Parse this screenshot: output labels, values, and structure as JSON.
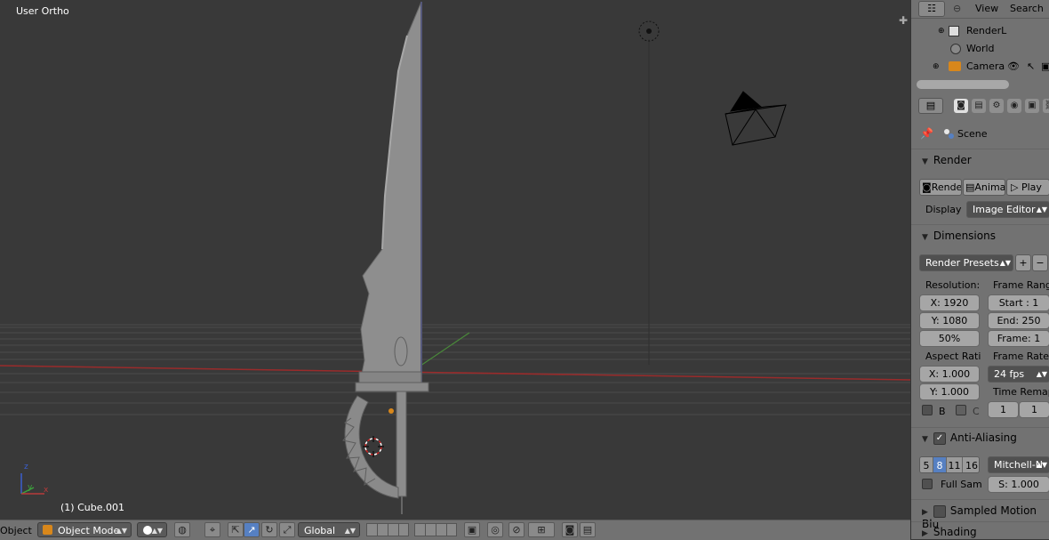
{
  "viewport": {
    "title": "User Ortho",
    "object_info": "(1) Cube.001",
    "axis_labels": {
      "z": "z",
      "y": "y",
      "x": "x"
    }
  },
  "bottombar": {
    "left_label": "Object",
    "mode": "Object Mode",
    "orientation": "Global"
  },
  "outliner": {
    "view_menu": "View",
    "search_menu": "Search",
    "items": [
      {
        "label": "RenderL",
        "icon": "render-layers-icon"
      },
      {
        "label": "World",
        "icon": "world-icon"
      },
      {
        "label": "Camera",
        "icon": "camera-icon"
      }
    ]
  },
  "properties": {
    "context": "Scene",
    "render": {
      "title": "Render",
      "render_btn": "Rende",
      "anim_btn": "Anima",
      "play_btn": "Play",
      "display_label": "Display",
      "display_value": "Image Editor"
    },
    "dimensions": {
      "title": "Dimensions",
      "presets": "Render Presets",
      "resolution_label": "Resolution:",
      "res_x": "X: 1920",
      "res_y": "Y: 1080",
      "res_pct": "50%",
      "frame_range_label": "Frame Rang",
      "start": "Start : 1",
      "end": "End: 250",
      "frame": "Frame: 1",
      "aspect_label": "Aspect Rati",
      "aspect_x": "X: 1.000",
      "aspect_y": "Y: 1.000",
      "frame_rate_label": "Frame Rate:",
      "fps": "24 fps",
      "time_remap_label": "Time Remap",
      "remap_old": "1",
      "remap_new": "1",
      "border_label": "B",
      "crop_label": "C"
    },
    "antialiasing": {
      "title": "Anti-Aliasing",
      "samples": [
        "5",
        "8",
        "11",
        "16"
      ],
      "active_sample": "8",
      "filter": "Mitchell-N",
      "full_sample_label": "Full Sam",
      "size": "S: 1.000"
    },
    "sampled_motion_blur": {
      "title": "Sampled Motion Blu"
    },
    "shading": {
      "title": "Shading"
    }
  },
  "colors": {
    "viewport_bg": "#393939",
    "panel_bg": "#727272",
    "accent": "#5680c2",
    "x_axis": "#a03030",
    "y_axis": "#4a8a3a"
  }
}
